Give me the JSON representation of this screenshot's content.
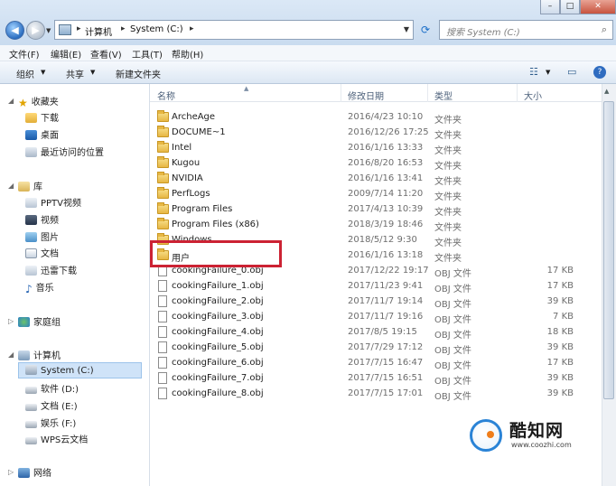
{
  "address": {
    "segments": [
      "计算机",
      "System (C:)"
    ]
  },
  "search": {
    "placeholder": "搜索 System (C:)"
  },
  "menu": [
    "文件(F)",
    "编辑(E)",
    "查看(V)",
    "工具(T)",
    "帮助(H)"
  ],
  "toolbar": {
    "organize": "组织",
    "share": "共享",
    "new_folder": "新建文件夹"
  },
  "sidebar": {
    "favorites": {
      "title": "收藏夹",
      "items": [
        "下载",
        "桌面",
        "最近访问的位置"
      ]
    },
    "libraries": {
      "title": "库",
      "items": [
        "PPTV视频",
        "视频",
        "图片",
        "文档",
        "迅雷下载",
        "音乐"
      ]
    },
    "homegroup": "家庭组",
    "computer": {
      "title": "计算机",
      "items": [
        "System (C:)",
        "软件 (D:)",
        "文档 (E:)",
        "娱乐 (F:)",
        "WPS云文档"
      ]
    },
    "network": "网络"
  },
  "columns": [
    "名称",
    "修改日期",
    "类型",
    "大小"
  ],
  "files": [
    {
      "name": "ArcheAge",
      "date": "2016/4/23 10:10",
      "type": "文件夹",
      "size": "",
      "folder": true
    },
    {
      "name": "DOCUME~1",
      "date": "2016/12/26 17:25",
      "type": "文件夹",
      "size": "",
      "folder": true
    },
    {
      "name": "Intel",
      "date": "2016/1/16 13:33",
      "type": "文件夹",
      "size": "",
      "folder": true
    },
    {
      "name": "Kugou",
      "date": "2016/8/20 16:53",
      "type": "文件夹",
      "size": "",
      "folder": true
    },
    {
      "name": "NVIDIA",
      "date": "2016/1/16 13:41",
      "type": "文件夹",
      "size": "",
      "folder": true
    },
    {
      "name": "PerfLogs",
      "date": "2009/7/14 11:20",
      "type": "文件夹",
      "size": "",
      "folder": true
    },
    {
      "name": "Program Files",
      "date": "2017/4/13 10:39",
      "type": "文件夹",
      "size": "",
      "folder": true
    },
    {
      "name": "Program Files (x86)",
      "date": "2018/3/19 18:46",
      "type": "文件夹",
      "size": "",
      "folder": true
    },
    {
      "name": "Windows",
      "date": "2018/5/12 9:30",
      "type": "文件夹",
      "size": "",
      "folder": true
    },
    {
      "name": "用户",
      "date": "2016/1/16 13:18",
      "type": "文件夹",
      "size": "",
      "folder": true
    },
    {
      "name": "cookingFailure_0.obj",
      "date": "2017/12/22 19:17",
      "type": "OBJ 文件",
      "size": "17 KB",
      "folder": false
    },
    {
      "name": "cookingFailure_1.obj",
      "date": "2017/11/23 9:41",
      "type": "OBJ 文件",
      "size": "17 KB",
      "folder": false
    },
    {
      "name": "cookingFailure_2.obj",
      "date": "2017/11/7 19:14",
      "type": "OBJ 文件",
      "size": "39 KB",
      "folder": false
    },
    {
      "name": "cookingFailure_3.obj",
      "date": "2017/11/7 19:16",
      "type": "OBJ 文件",
      "size": "7 KB",
      "folder": false
    },
    {
      "name": "cookingFailure_4.obj",
      "date": "2017/8/5 19:15",
      "type": "OBJ 文件",
      "size": "18 KB",
      "folder": false
    },
    {
      "name": "cookingFailure_5.obj",
      "date": "2017/7/29 17:12",
      "type": "OBJ 文件",
      "size": "39 KB",
      "folder": false
    },
    {
      "name": "cookingFailure_6.obj",
      "date": "2017/7/15 16:47",
      "type": "OBJ 文件",
      "size": "17 KB",
      "folder": false
    },
    {
      "name": "cookingFailure_7.obj",
      "date": "2017/7/15 16:51",
      "type": "OBJ 文件",
      "size": "39 KB",
      "folder": false
    },
    {
      "name": "cookingFailure_8.obj",
      "date": "2017/7/15 17:01",
      "type": "OBJ 文件",
      "size": "39 KB",
      "folder": false
    }
  ],
  "highlight_color": "#cc2233",
  "watermark": {
    "title": "酷知网",
    "url": "www.coozhi.com"
  }
}
